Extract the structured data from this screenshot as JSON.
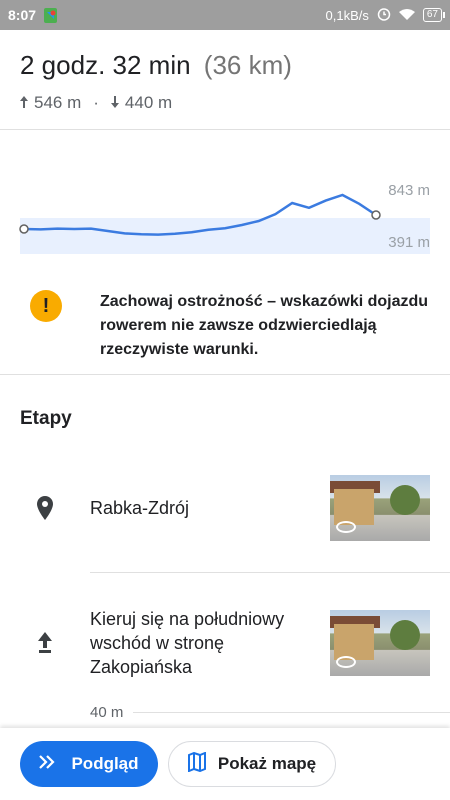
{
  "status_bar": {
    "time": "8:07",
    "network_speed": "0,1kB/s",
    "battery": "67",
    "icons": [
      "maps-icon",
      "alarm-icon",
      "wifi-icon",
      "battery-icon"
    ]
  },
  "summary": {
    "duration": "2 godz. 32 min",
    "distance": "(36 km)",
    "ascent": "546 m",
    "descent": "440 m",
    "separator": "·"
  },
  "elevation_chart": {
    "max_label": "843 m",
    "min_label": "391 m"
  },
  "chart_data": {
    "type": "area",
    "ylim": [
      391,
      843
    ],
    "series": [
      {
        "values": [
          0.85,
          0.86,
          0.84,
          0.85,
          0.84,
          0.9,
          0.96,
          0.98,
          0.99,
          0.97,
          0.93,
          0.87,
          0.83,
          0.75,
          0.65,
          0.48,
          0.2,
          0.32,
          0.14,
          0.0,
          0.22,
          0.5
        ]
      }
    ]
  },
  "warning": {
    "icon": "exclamation-icon",
    "text": "Zachowaj ostrożność – wskazówki dojazdu rowerem nie zawsze odzwierciedlają rzeczywiste warunki."
  },
  "steps_section": {
    "title": "Etapy",
    "steps": [
      {
        "icon": "pin-icon",
        "text": "Rabka-Zdrój"
      },
      {
        "icon": "arrow-up-icon",
        "text": "Kieruj się na południowy wschód w stronę Zakopiańska"
      }
    ],
    "distance_after": "40 m"
  },
  "bottom_bar": {
    "preview_label": "Podgląd",
    "map_label": "Pokaż mapę"
  },
  "colors": {
    "accent": "#1a73e8",
    "warning": "#f9ab00",
    "chart_line": "#3b7be0",
    "chart_fill": "#e8f0fe"
  }
}
